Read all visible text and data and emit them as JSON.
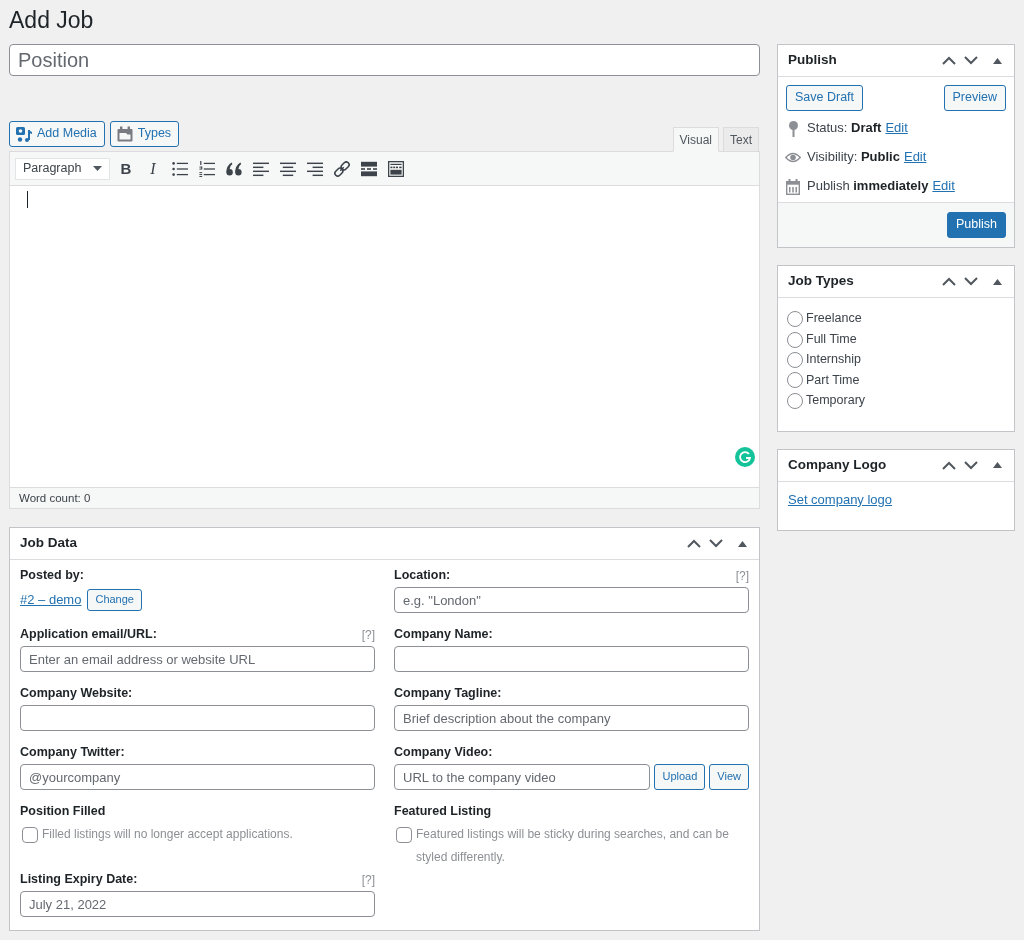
{
  "page_title": "Add Job",
  "title_field": {
    "placeholder": "Position"
  },
  "media_buttons": [
    {
      "kind": "media",
      "label": "Add Media"
    },
    {
      "kind": "types",
      "label": "Types"
    }
  ],
  "editor_tabs": [
    {
      "label": "Visual",
      "selected": true
    },
    {
      "label": "Text",
      "selected": false
    }
  ],
  "toolbar": {
    "format": "Paragraph",
    "tools": [
      {
        "kind": "bold",
        "glyph": "B"
      },
      {
        "kind": "italic",
        "glyph": "I"
      },
      {
        "kind": "bullet_list"
      },
      {
        "kind": "numbered_list"
      },
      {
        "kind": "blockquote"
      },
      {
        "kind": "align_left"
      },
      {
        "kind": "align_center"
      },
      {
        "kind": "align_right"
      },
      {
        "kind": "link"
      },
      {
        "kind": "read_more"
      },
      {
        "kind": "toolbar_toggle"
      }
    ]
  },
  "editor": {
    "focused": true,
    "word_count": "Word count: 0"
  },
  "job_data": {
    "title": "Job Data",
    "fields": [
      {
        "kind": "author",
        "label": "Posted by:",
        "link": "#2 – demo",
        "button": "Change"
      },
      {
        "kind": "text",
        "label": "Location:",
        "help": "[?]",
        "placeholder": "e.g. \"London\""
      },
      {
        "kind": "text",
        "label": "Application email/URL:",
        "help": "[?]",
        "placeholder": "Enter an email address or website URL"
      },
      {
        "kind": "text",
        "label": "Company Name:"
      },
      {
        "kind": "text",
        "label": "Company Website:"
      },
      {
        "kind": "text",
        "label": "Company Tagline:",
        "placeholder": "Brief description about the company"
      },
      {
        "kind": "text",
        "label": "Company Twitter:",
        "placeholder": "@yourcompany"
      },
      {
        "kind": "file",
        "label": "Company Video:",
        "placeholder": "URL to the company video",
        "buttons": [
          "Upload",
          "View"
        ]
      },
      {
        "kind": "checkbox",
        "label": "Position Filled",
        "description": "Filled listings will no longer accept applications.",
        "checked": false
      },
      {
        "kind": "checkbox",
        "label": "Featured Listing",
        "description": "Featured listings will be sticky during searches, and can be styled differently.",
        "checked": false
      },
      {
        "kind": "text",
        "label": "Listing Expiry Date:",
        "help": "[?]",
        "placeholder": "July 21, 2022"
      }
    ]
  },
  "publish": {
    "title": "Publish",
    "save_draft": "Save Draft",
    "preview": "Preview",
    "rows": [
      {
        "kind": "status",
        "text": "Status: **Draft**",
        "link": "Edit"
      },
      {
        "kind": "visibility",
        "text": "Visibility: **Public**",
        "link": "Edit"
      },
      {
        "kind": "schedule",
        "text": "Publish **immediately**",
        "link": "Edit"
      }
    ],
    "button": "Publish"
  },
  "job_types": {
    "title": "Job Types",
    "options": [
      {
        "label": "Freelance",
        "selected": false
      },
      {
        "label": "Full Time",
        "selected": false
      },
      {
        "label": "Internship",
        "selected": false
      },
      {
        "label": "Part Time",
        "selected": false
      },
      {
        "label": "Temporary",
        "selected": false
      }
    ]
  },
  "company_logo": {
    "title": "Company Logo",
    "link": "Set company logo"
  }
}
